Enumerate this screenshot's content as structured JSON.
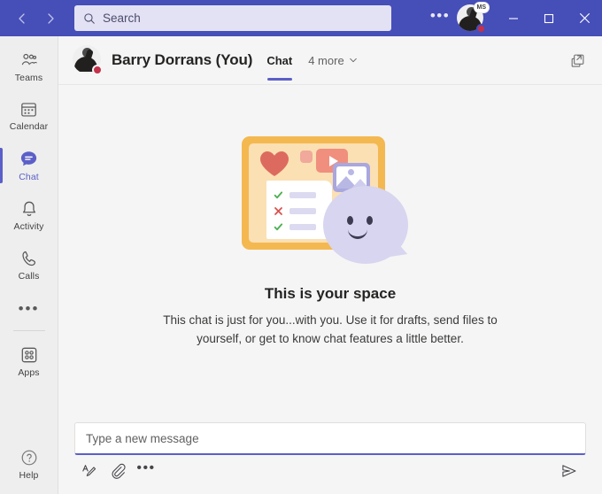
{
  "titlebar": {
    "back_label": "Back",
    "forward_label": "Forward",
    "search": {
      "placeholder": "Search",
      "value": "",
      "icon": "search-icon"
    },
    "more_label": "•••",
    "account": {
      "badge": "MS",
      "presence": "Do not disturb",
      "presence_color": "#c4314b"
    },
    "window": {
      "minimize_label": "Minimize",
      "maximize_label": "Maximize",
      "close_label": "Close"
    },
    "background_color": "#464eb8"
  },
  "rail": {
    "items": [
      {
        "label": "Teams",
        "icon": "teams-icon",
        "active": false
      },
      {
        "label": "Calendar",
        "icon": "calendar-icon",
        "active": false
      },
      {
        "label": "Chat",
        "icon": "chat-icon",
        "active": true
      },
      {
        "label": "Activity",
        "icon": "bell-icon",
        "active": false
      },
      {
        "label": "Calls",
        "icon": "phone-icon",
        "active": false
      }
    ],
    "more_label": "•••",
    "apps": {
      "label": "Apps",
      "icon": "apps-grid-icon"
    },
    "help": {
      "label": "Help",
      "icon": "question-circle-icon"
    },
    "accent_color": "#5b5fc7"
  },
  "chat_header": {
    "title": "Barry Dorrans (You)",
    "presence": "Do not disturb",
    "tabs": [
      {
        "label": "Chat",
        "active": true
      }
    ],
    "more_tabs_label": "4 more",
    "popout_label": "Pop out chat"
  },
  "empty_state": {
    "title": "This is your space",
    "subtitle": "This chat is just for you...with you. Use it for drafts, send files to yourself, or get to know chat features a little better.",
    "illustration": "personal-space-illustration"
  },
  "compose": {
    "placeholder": "Type a new message",
    "value": "",
    "tools": [
      {
        "label": "Format",
        "icon": "format-text-icon"
      },
      {
        "label": "Attach",
        "icon": "paperclip-icon"
      },
      {
        "label": "More options",
        "icon": "ellipsis-icon"
      }
    ],
    "send_label": "Send",
    "accent_color": "#5b5fc7"
  }
}
